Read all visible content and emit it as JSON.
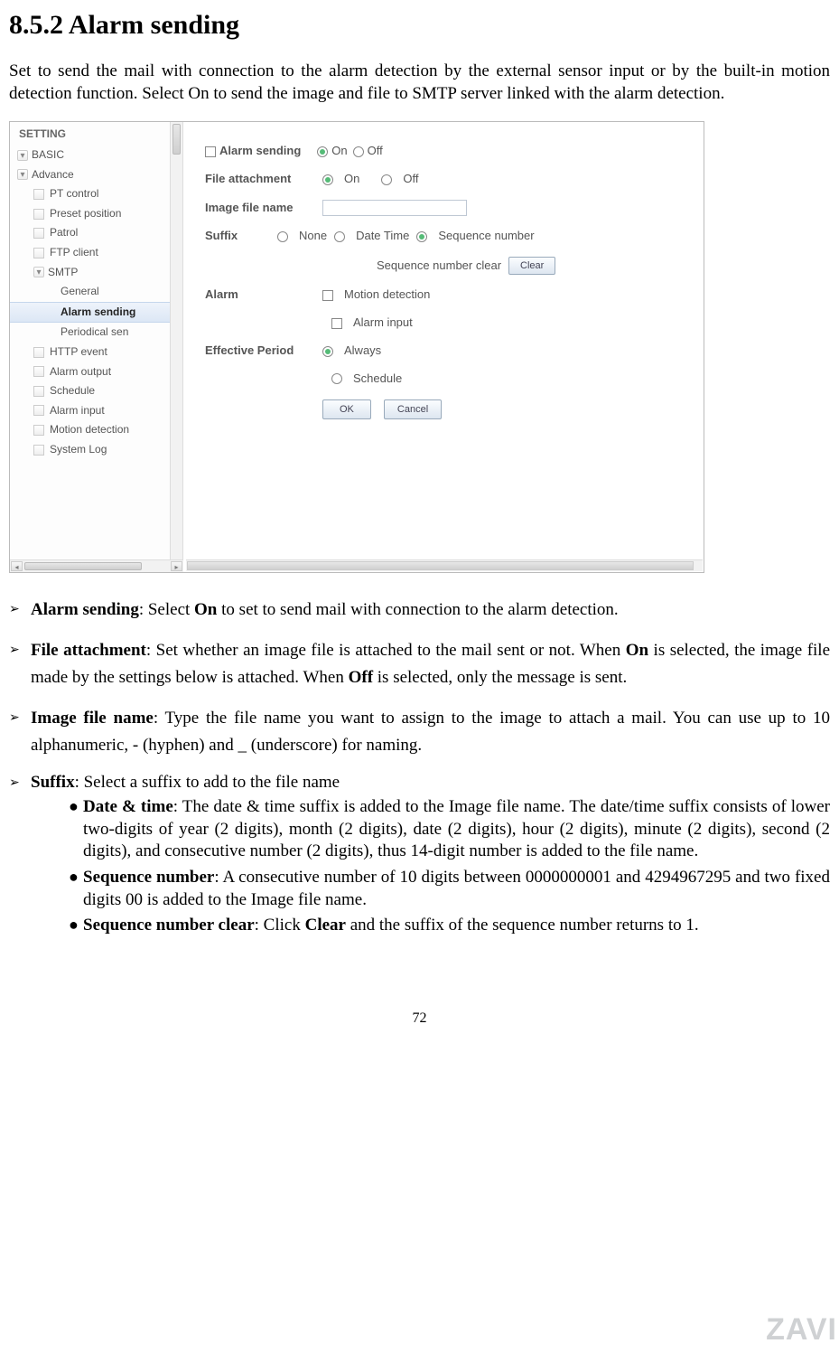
{
  "heading": "8.5.2 Alarm sending",
  "intro": "Set to send the mail with connection to the alarm detection by the external sensor input or by the built-in motion detection function. Select On to send the image and file to SMTP server linked with the alarm detection.",
  "screenshot": {
    "sidebar": {
      "title": "SETTING",
      "items": [
        {
          "label": "BASIC",
          "kind": "arrow"
        },
        {
          "label": "Advance",
          "kind": "arrow"
        },
        {
          "label": "PT control",
          "kind": "page",
          "level": 2
        },
        {
          "label": "Preset position",
          "kind": "page",
          "level": 2
        },
        {
          "label": "Patrol",
          "kind": "page",
          "level": 2
        },
        {
          "label": "FTP client",
          "kind": "page",
          "level": 2
        },
        {
          "label": "SMTP",
          "kind": "arrow",
          "level": 2
        },
        {
          "label": "General",
          "kind": "none",
          "level": 3
        },
        {
          "label": "Alarm sending",
          "kind": "none",
          "level": 3,
          "selected": true
        },
        {
          "label": "Periodical sen",
          "kind": "none",
          "level": 3
        },
        {
          "label": "HTTP event",
          "kind": "page",
          "level": 2
        },
        {
          "label": "Alarm output",
          "kind": "page",
          "level": 2
        },
        {
          "label": "Schedule",
          "kind": "page",
          "level": 2
        },
        {
          "label": "Alarm input",
          "kind": "page",
          "level": 2
        },
        {
          "label": "Motion detection",
          "kind": "page",
          "level": 2
        },
        {
          "label": "System Log",
          "kind": "page",
          "level": 2
        }
      ]
    },
    "form": {
      "alarm_sending_label": "Alarm sending",
      "on": "On",
      "off": "Off",
      "file_attachment_label": "File attachment",
      "image_file_name_label": "Image file name",
      "image_file_name_value": "",
      "suffix_label": "Suffix",
      "suffix_none": "None",
      "suffix_datetime": "Date Time",
      "suffix_seq": "Sequence number",
      "seq_clear_label": "Sequence number clear",
      "clear_btn": "Clear",
      "alarm_label": "Alarm",
      "motion_detection": "Motion detection",
      "alarm_input": "Alarm input",
      "effective_label": "Effective Period",
      "always": "Always",
      "schedule": "Schedule",
      "ok_btn": "OK",
      "cancel_btn": "Cancel"
    }
  },
  "defs": {
    "alarm_sending": {
      "title": "Alarm sending",
      "on_word": "On",
      "rest": " to set to send mail with connection to the alarm detection."
    },
    "file_attachment": {
      "title": "File attachment",
      "p1a": ": Set whether an image file is attached to the mail sent or not. When ",
      "on_word": "On",
      "p1b": " is selected, the image file made by the settings below is attached. When ",
      "off_word": "Off",
      "p1c": " is selected, only the message is sent."
    },
    "image_file_name": {
      "title": "Image file name",
      "p1": ": Type the file name you want to assign to the image to attach a mail. You can use up to 10 alphanumeric, - (hyphen) and _ (underscore) for naming."
    },
    "suffix": {
      "title": "Suffix",
      "p1": ": Select a suffix to add to the file name",
      "date_time_title": "Date & time",
      "date_time_body": ": The date & time suffix is added to the Image file name. The date/time suffix consists of lower two-digits of year (2 digits), month (2 digits), date (2 digits), hour (2 digits), minute (2 digits), second (2 digits), and consecutive number (2 digits), thus 14-digit number is added to the file name.",
      "seq_num_title": "Sequence number",
      "seq_num_body": ": A consecutive number of 10 digits between 0000000001 and 4294967295 and two fixed digits 00 is added to the Image file name.",
      "seq_clear_title": "Sequence number clear",
      "seq_clear_a": ": Click ",
      "seq_clear_word": "Clear",
      "seq_clear_b": " and the suffix of the sequence number returns to 1."
    }
  },
  "pagenum": "72",
  "watermark": "ZAVI"
}
